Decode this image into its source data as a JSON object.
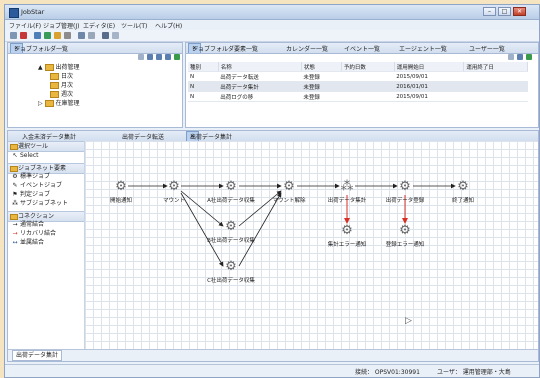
{
  "window": {
    "title": "JobStar"
  },
  "menu": [
    "ファイル(F)",
    "ジョブ管理(J)",
    "エディタ(E)",
    "ツール(T)",
    "ヘルプ(H)"
  ],
  "left_view": {
    "tab": "ジョブフォルダ一覧",
    "tree": [
      {
        "label": "出荷管理"
      },
      {
        "label": "日次"
      },
      {
        "label": "月次"
      },
      {
        "label": "週次"
      },
      {
        "label": "在庫管理"
      }
    ]
  },
  "top_tabs": [
    "ジョブフォルダ要素一覧",
    "カレンダー一覧",
    "イベント一覧",
    "エージェント一覧",
    "ユーザー一覧"
  ],
  "job_table": {
    "columns": [
      "種別",
      "名称",
      "状態",
      "予約日数",
      "運用開始日",
      "運用終了日"
    ],
    "rows": [
      [
        "N",
        "出荷データ転送",
        "未登録",
        "",
        "2015/09/01",
        ""
      ],
      [
        "N",
        "出荷データ集計",
        "未登録",
        "",
        "2016/01/01",
        ""
      ],
      [
        "N",
        "出荷ログの移",
        "未登録",
        "",
        "2015/09/01",
        ""
      ]
    ]
  },
  "editor_tabs": [
    "入金未済データ集計",
    "出荷データ転送",
    "出荷データ集計"
  ],
  "palette": {
    "groups": [
      {
        "label": "選択ツール",
        "items": [
          {
            "label": "Select",
            "icon": "pointer"
          }
        ]
      },
      {
        "label": "ジョブネット要素",
        "items": [
          {
            "label": "標準ジョブ",
            "icon": "gear"
          },
          {
            "label": "イベントジョブ",
            "icon": "event"
          },
          {
            "label": "判定ジョブ",
            "icon": "flag"
          },
          {
            "label": "サブジョブネット",
            "icon": "sub"
          }
        ]
      },
      {
        "label": "コネクション",
        "items": [
          {
            "label": "通常結合",
            "icon": "arrow-black"
          },
          {
            "label": "リカバリ結合",
            "icon": "arrow-red"
          },
          {
            "label": "並属結合",
            "icon": "arrow-both"
          }
        ]
      }
    ]
  },
  "flow": {
    "nodes": [
      {
        "id": "n0",
        "label": "開始通知"
      },
      {
        "id": "n1",
        "label": "マウント"
      },
      {
        "id": "n2",
        "label": "A社出荷データ収集"
      },
      {
        "id": "n3",
        "label": "B社出荷データ収集"
      },
      {
        "id": "n4",
        "label": "C社出荷データ収集"
      },
      {
        "id": "n5",
        "label": "マウント解除"
      },
      {
        "id": "n6",
        "label": "出荷データ集計"
      },
      {
        "id": "n7",
        "label": "出荷データ登録"
      },
      {
        "id": "n8",
        "label": "終了通知"
      },
      {
        "id": "n9",
        "label": "集計エラー通知"
      },
      {
        "id": "n10",
        "label": "登録エラー通知"
      }
    ]
  },
  "bottom_tab": "出荷データ集計",
  "status": {
    "connection": "接続： OPSV01:30991",
    "user": "ユーザ： 運用管理部・大島"
  },
  "colors": {
    "accent": "#2d5a9c",
    "recovery": "#d93025",
    "folder": "#e9b640"
  }
}
